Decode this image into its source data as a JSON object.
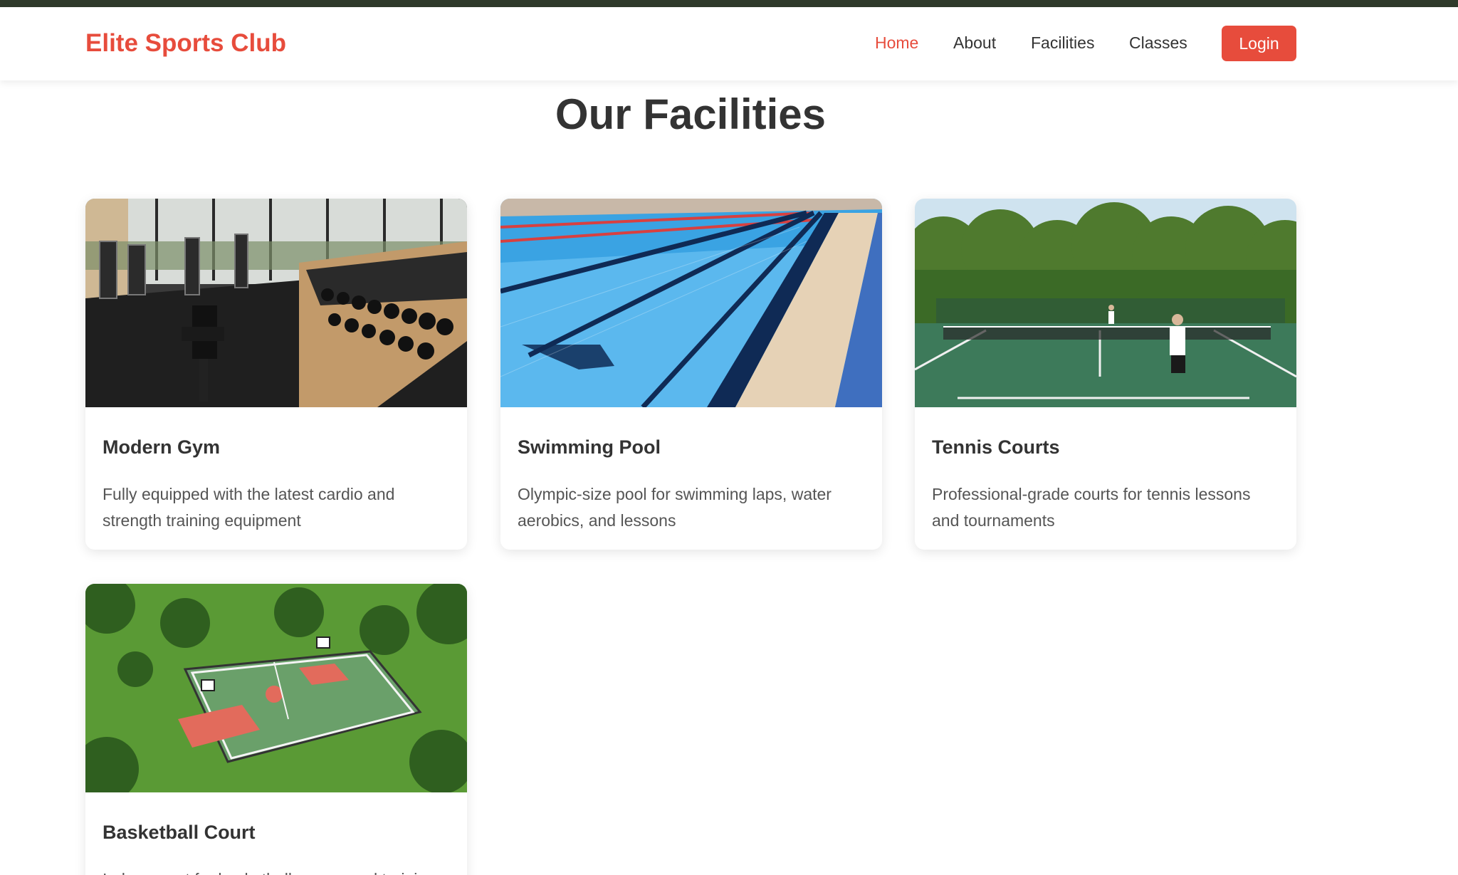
{
  "brand": {
    "name": "Elite Sports Club",
    "accent_color": "#e74c3c"
  },
  "nav": {
    "items": [
      {
        "label": "Home",
        "active": true
      },
      {
        "label": "About",
        "active": false
      },
      {
        "label": "Facilities",
        "active": false
      },
      {
        "label": "Classes",
        "active": false
      }
    ],
    "login_label": "Login"
  },
  "main": {
    "title": "Our Facilities",
    "facilities": [
      {
        "title": "Modern Gym",
        "description": "Fully equipped with the latest cardio and strength training equipment",
        "image": "gym-photo"
      },
      {
        "title": "Swimming Pool",
        "description": "Olympic-size pool for swimming laps, water aerobics, and lessons",
        "image": "pool-photo"
      },
      {
        "title": "Tennis Courts",
        "description": "Professional-grade courts for tennis lessons and tournaments",
        "image": "tennis-photo"
      },
      {
        "title": "Basketball Court",
        "description": "Indoor court for basketball games and training",
        "image": "basketball-photo"
      }
    ]
  }
}
